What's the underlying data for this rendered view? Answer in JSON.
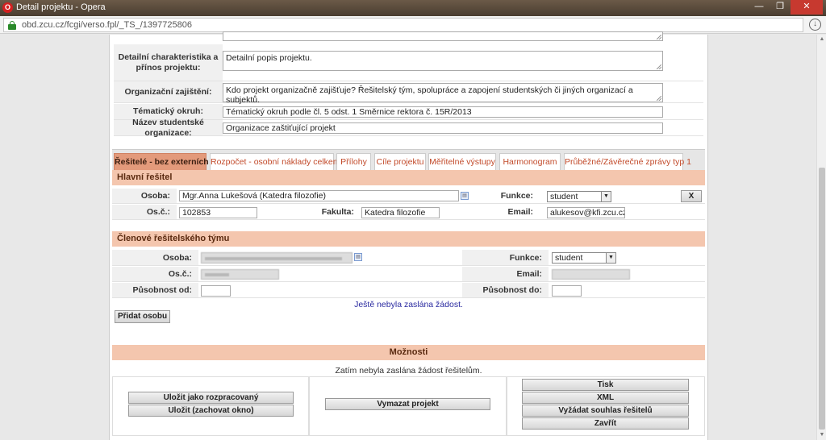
{
  "window": {
    "title": "Detail projektu - Opera",
    "url": "obd.zcu.cz/fcgi/verso.fpl/_TS_/1397725806",
    "minimize": "—",
    "maximize": "❐",
    "close": "✕"
  },
  "project": {
    "char_label": "Detailní charakteristika a přínos projektu:",
    "char_value": "Detailní popis projektu.",
    "org_label": "Organizační zajištění:",
    "org_value": "Kdo projekt organizačně zajišťuje? Řešitelský tým, spolupráce a zapojení studentských či jiných organizací a subjektů.",
    "topic_label": "Tématický okruh:",
    "topic_value": "Tématický okruh podle čl. 5 odst. 1 Směrnice rektora č. 15R/2013",
    "student_org_label": "Název studentské organizace:",
    "student_org_value": "Organizace zaštiťující projekt"
  },
  "tabs": [
    {
      "label": "Řešitelé - bez externích",
      "active": true
    },
    {
      "label": "Rozpočet - osobní náklady celkem"
    },
    {
      "label": "Přílohy"
    },
    {
      "label": "Cíle projektu"
    },
    {
      "label": "Měřitelné výstupy"
    },
    {
      "label": "Harmonogram"
    },
    {
      "label": "Průběžné/Závěrečné zprávy typ 1"
    }
  ],
  "lead": {
    "section_title": "Hlavní řešitel",
    "person_label": "Osoba:",
    "person_value": "Mgr.Anna Lukešová  (Katedra filozofie)",
    "function_label": "Funkce:",
    "function_value": "student",
    "remove_label": "X",
    "id_label": "Os.č.:",
    "id_value": "102853",
    "faculty_label": "Fakulta:",
    "faculty_value": "Katedra filozofie",
    "email_label": "Email:",
    "email_value": "alukesov@kfi.zcu.cz"
  },
  "team": {
    "section_title": "Členové řešitelského týmu",
    "person_label": "Osoba:",
    "function_label": "Funkce:",
    "function_value": "student",
    "id_label": "Os.č.:",
    "email_label": "Email:",
    "from_label": "Působnost od:",
    "to_label": "Působnost do:",
    "note": "Ještě nebyla zaslána žádost.",
    "add_person": "Přidat osobu"
  },
  "options": {
    "section_title": "Možnosti",
    "status": "Zatím nebyla zaslána žádost řešitelům.",
    "save_draft": "Uložit jako rozpracovaný",
    "save_keep": "Uložit (zachovat okno)",
    "delete_project": "Vymazat projekt",
    "print": "Tisk",
    "xml": "XML",
    "request_consent": "Vyžádat souhlas řešitelů",
    "close": "Zavřít"
  },
  "colors": {
    "accent": "#e39a7b",
    "section": "#f4c6ae",
    "link": "#c24a2a"
  }
}
